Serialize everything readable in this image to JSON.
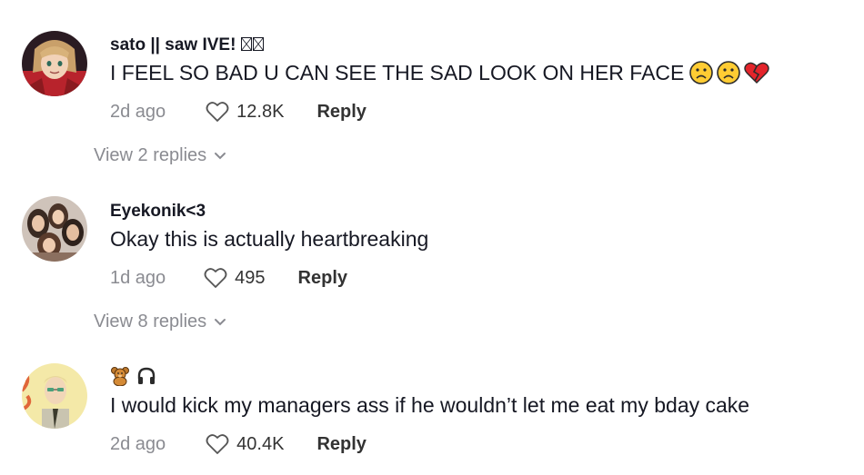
{
  "comments": [
    {
      "username": "sato || saw IVE!",
      "text": "I FEEL SO BAD U CAN SEE THE SAD LOOK ON HER FACE",
      "emojis": [
        "frowning-face",
        "frowning-face",
        "broken-heart"
      ],
      "date": "2d ago",
      "likes": "12.8K",
      "reply_label": "Reply",
      "view_replies": "View 2 replies"
    },
    {
      "username": "Eyekonik<3",
      "text": "Okay this is actually heartbreaking",
      "date": "1d ago",
      "likes": "495",
      "reply_label": "Reply",
      "view_replies": "View 8 replies"
    },
    {
      "username_emojis": [
        "teddy-bear",
        "headphones"
      ],
      "text": "I would kick my managers ass if he wouldn’t let me eat my bday cake",
      "date": "2d ago",
      "likes": "40.4K",
      "reply_label": "Reply"
    }
  ],
  "colors": {
    "primary_text": "#161823",
    "secondary_text": "#8a8b91",
    "action_text": "#333333"
  }
}
